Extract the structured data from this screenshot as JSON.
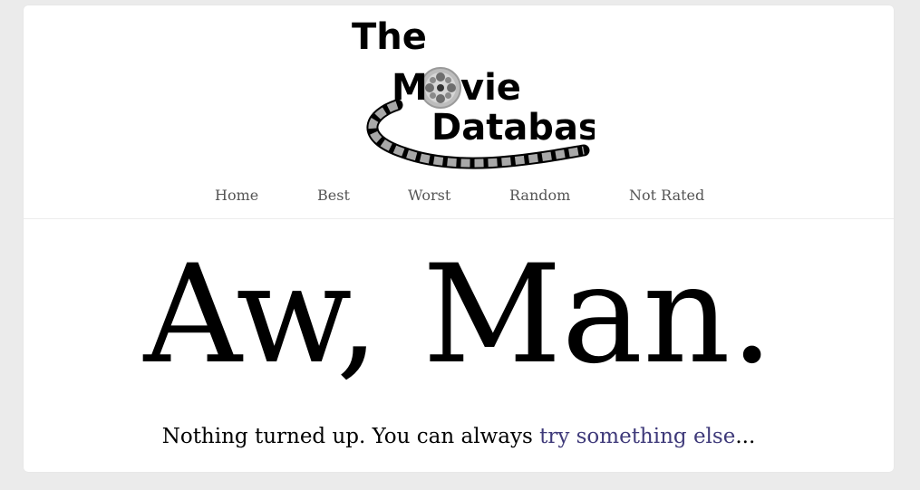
{
  "logo": {
    "line1": "The",
    "line2_pre": "M",
    "line2_post": "vie",
    "line3": "Database",
    "icon": "film-reel-icon"
  },
  "nav": {
    "items": [
      {
        "label": "Home"
      },
      {
        "label": "Best"
      },
      {
        "label": "Worst"
      },
      {
        "label": "Random"
      },
      {
        "label": "Not Rated"
      }
    ]
  },
  "main": {
    "headline": "Aw, Man.",
    "message_prefix": "Nothing turned up. You can always ",
    "message_link": "try something else",
    "message_suffix": "..."
  },
  "colors": {
    "background": "#ebebeb",
    "card": "#ffffff",
    "nav_text": "#555555",
    "link": "#3f3a7a"
  }
}
